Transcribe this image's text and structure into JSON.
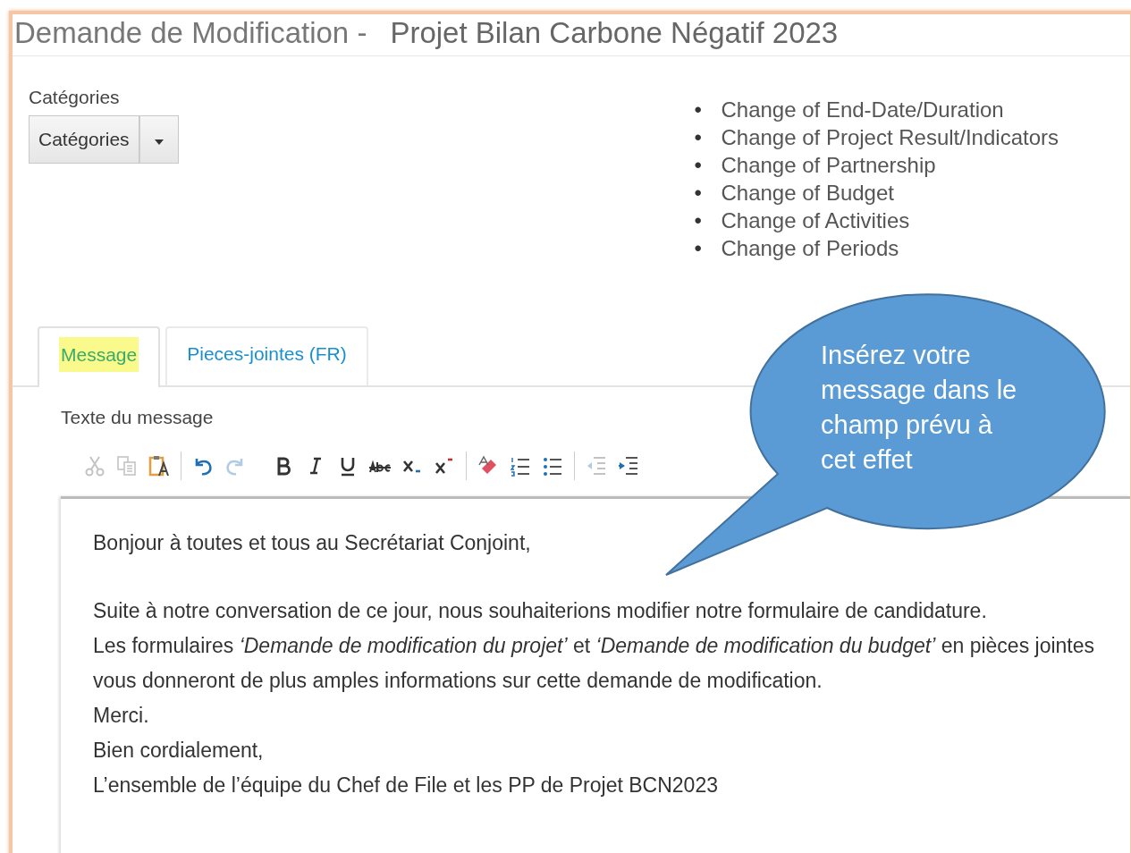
{
  "title": {
    "prefix": "Demande de Modification -",
    "project": "Projet Bilan Carbone Négatif 2023"
  },
  "categories": {
    "label": "Catégories",
    "button": "Catégories"
  },
  "change_marker": "•",
  "change_types": [
    "Change of End-Date/Duration",
    "Change of Project Result/Indicators",
    "Change of Partnership",
    "Change of Budget",
    "Change of Activities",
    "Change of Periods"
  ],
  "tabs": [
    {
      "label": "Message",
      "selected": true,
      "highlighted": true
    },
    {
      "label": "Pieces-jointes (FR)",
      "selected": false,
      "highlighted": false
    }
  ],
  "editor": {
    "label": "Texte du message",
    "toolbar": [
      {
        "kind": "cut",
        "disabled": true
      },
      {
        "kind": "copy",
        "disabled": true
      },
      {
        "kind": "paste-text",
        "disabled": false
      },
      {
        "kind": "sep"
      },
      {
        "kind": "undo",
        "disabled": false
      },
      {
        "kind": "redo",
        "disabled": true
      },
      {
        "kind": "gap"
      },
      {
        "kind": "bold",
        "disabled": false
      },
      {
        "kind": "italic",
        "disabled": false
      },
      {
        "kind": "underline",
        "disabled": false
      },
      {
        "kind": "strike",
        "disabled": false
      },
      {
        "kind": "subscript",
        "disabled": false
      },
      {
        "kind": "superscript",
        "disabled": false
      },
      {
        "kind": "sep"
      },
      {
        "kind": "eraser",
        "disabled": false
      },
      {
        "kind": "numbered-list",
        "disabled": false
      },
      {
        "kind": "bulleted-list",
        "disabled": false
      },
      {
        "kind": "sep"
      },
      {
        "kind": "outdent",
        "disabled": true
      },
      {
        "kind": "indent",
        "disabled": false
      }
    ],
    "paragraphs": [
      "Bonjour à toutes et tous au Secrétariat Conjoint,",
      "Suite à notre conversation de ce jour, nous souhaiterions modifier notre formulaire de candidature.",
      "Les formulaires *‘Demande de modification du projet’* et *‘Demande de modification du budget’* en pièces jointes vous donneront de plus amples informations sur cette demande de modification.",
      "Merci.",
      "Bien cordialement,",
      "L’ensemble de l’équipe du Chef de File et les PP de Projet BCN2023"
    ]
  },
  "callout": {
    "text": "Insérez votre message dans le champ prévu à cet effet"
  }
}
